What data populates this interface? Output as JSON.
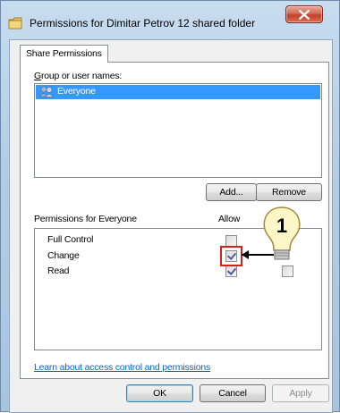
{
  "window": {
    "title": "Permissions for Dimitar Petrov 12 shared folder",
    "close_label": "X"
  },
  "tabs": [
    {
      "label": "Share Permissions"
    }
  ],
  "groups": {
    "label": "Group or user names:",
    "items": [
      {
        "name": "Everyone",
        "icon": "users-icon",
        "selected": true
      }
    ]
  },
  "buttons": {
    "add": "Add...",
    "remove": "Remove",
    "ok": "OK",
    "cancel": "Cancel",
    "apply": "Apply"
  },
  "permissions": {
    "label": "Permissions for Everyone",
    "allow_header": "Allow",
    "rows": [
      {
        "name": "Full Control",
        "allow": false,
        "deny": false
      },
      {
        "name": "Change",
        "allow": true,
        "deny": false
      },
      {
        "name": "Read",
        "allow": true,
        "deny": false
      }
    ]
  },
  "callout": {
    "number": "1",
    "icon": "lightbulb-icon"
  },
  "link": "Learn about access control and permissions",
  "colors": {
    "selection": "#3399ff",
    "highlight": "#d62020",
    "link": "#0066cc"
  }
}
